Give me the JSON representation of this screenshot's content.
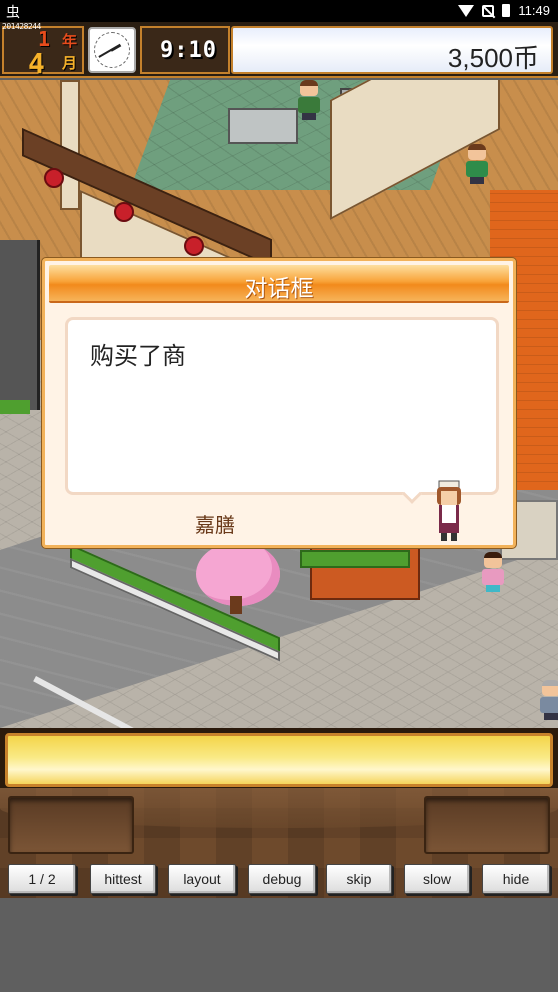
{
  "status_bar": {
    "app_glyph": "虫",
    "time": "11:49",
    "icons": [
      "wifi-icon",
      "signal-icon",
      "battery-icon"
    ]
  },
  "hud": {
    "seed": "201428244",
    "year_num": "1",
    "year_unit": "年",
    "month_num": "4",
    "month_unit": "月",
    "clock_icon": "analog-clock-icon",
    "time": "9:10",
    "money": "3,500币"
  },
  "dialog": {
    "title": "对话框",
    "message": "购买了商",
    "speaker": "嘉膳"
  },
  "debug_buttons": [
    "1 / 2",
    "hittest",
    "layout",
    "debug",
    "skip",
    "slow",
    "hide"
  ],
  "colors": {
    "accent_orange": "#f28a1c",
    "hud_border": "#c4812c",
    "date_red": "#e74c1c",
    "gold_bar": "#f4d44a"
  }
}
